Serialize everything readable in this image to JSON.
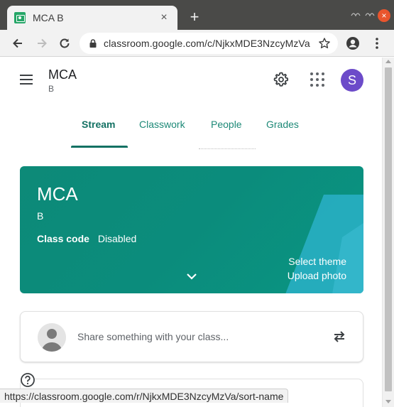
{
  "browser": {
    "tab_title": "MCA B",
    "tab_close": "×",
    "new_tab": "+",
    "window_close": "×",
    "url": "classroom.google.com/c/NjkxMDE3NzcyMzVa",
    "status_url": "https://classroom.google.com/r/NjkxMDE3NzcyMzVa/sort-name"
  },
  "header": {
    "class_name": "MCA",
    "section": "B",
    "avatar_letter": "S"
  },
  "tabs": [
    {
      "label": "Stream"
    },
    {
      "label": "Classwork"
    },
    {
      "label": "People"
    },
    {
      "label": "Grades"
    }
  ],
  "banner": {
    "title": "MCA",
    "section": "B",
    "class_code_label": "Class code",
    "class_code_value": "Disabled",
    "select_theme": "Select theme",
    "upload_photo": "Upload photo"
  },
  "share": {
    "placeholder": "Share something with your class..."
  },
  "colors": {
    "accent": "#137163",
    "banner": "#0d8a78",
    "avatar": "#6c4bc9",
    "close_button": "#e9552d"
  }
}
